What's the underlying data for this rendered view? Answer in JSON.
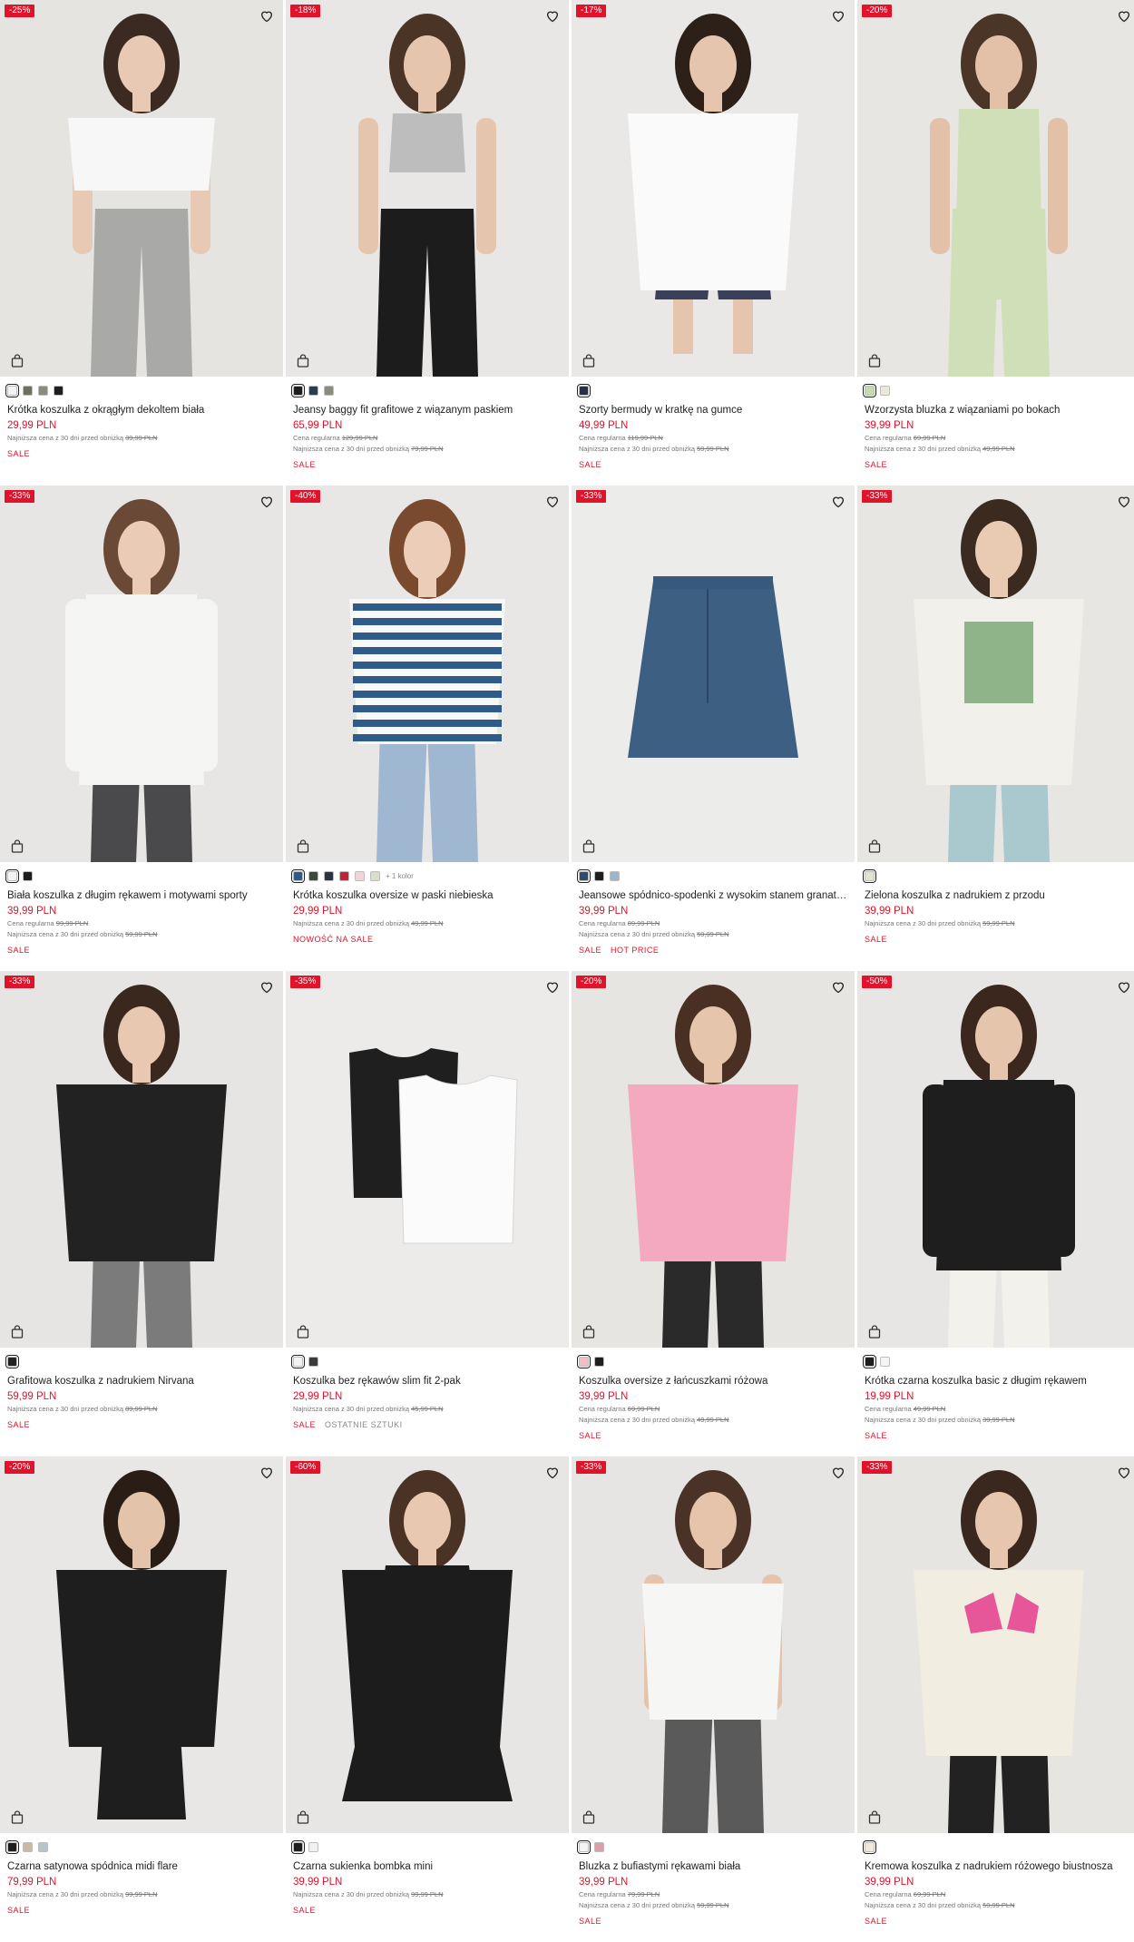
{
  "products": [
    {
      "badge": "-25%",
      "name": "Krótka koszulka z okrągłym dekoltem biała",
      "price": "29,99 PLN",
      "regular": "",
      "lowest_label": "Najniższa cena z 30 dni przed obniżką",
      "lowest_price": "39,99 PLN",
      "tags": [
        "SALE"
      ],
      "swatches": [
        "#f3f3f3",
        "#6b705f",
        "#8a8a80",
        "#1e1e1e"
      ],
      "more": ""
    },
    {
      "badge": "-18%",
      "name": "Jeansy baggy fit grafitowe z wiązanym paskiem",
      "price": "65,99 PLN",
      "regular_label": "Cena regularna",
      "regular": "129,99 PLN",
      "lowest_label": "Najniższa cena z 30 dni przed obniżką",
      "lowest_price": "79,99 PLN",
      "tags": [
        "SALE"
      ],
      "swatches": [
        "#1e1e1e",
        "#2a3d4f",
        "#8c8c7e"
      ],
      "more": ""
    },
    {
      "badge": "-17%",
      "name": "Szorty bermudy w kratkę na gumce",
      "price": "49,99 PLN",
      "regular_label": "Cena regularna",
      "regular": "119,99 PLN",
      "lowest_label": "Najniższa cena z 30 dni przed obniżką",
      "lowest_price": "59,99 PLN",
      "tags": [
        "SALE"
      ],
      "swatches": [
        "#2b2f45"
      ],
      "more": ""
    },
    {
      "badge": "-20%",
      "name": "Wzorzysta bluzka z wiązaniami po bokach",
      "price": "39,99 PLN",
      "regular_label": "Cena regularna",
      "regular": "69,99 PLN",
      "lowest_label": "Najniższa cena z 30 dni przed obniżką",
      "lowest_price": "49,99 PLN",
      "tags": [
        "SALE"
      ],
      "swatches": [
        "#c8d8b2",
        "#ece9dc"
      ],
      "more": ""
    },
    {
      "badge": "-33%",
      "name": "Biała koszulka z długim rękawem i motywami sporty",
      "price": "39,99 PLN",
      "regular_label": "Cena regularna",
      "regular": "99,99 PLN",
      "lowest_label": "Najniższa cena z 30 dni przed obniżką",
      "lowest_price": "59,99 PLN",
      "tags": [
        "SALE"
      ],
      "swatches": [
        "#f4f4f4",
        "#1e1e1e"
      ],
      "more": ""
    },
    {
      "badge": "-40%",
      "name": "Krótka koszulka oversize w paski niebieska",
      "price": "29,99 PLN",
      "regular": "",
      "lowest_label": "Najniższa cena z 30 dni przed obniżką",
      "lowest_price": "49,99 PLN",
      "tags": [
        "NOWOŚĆ NA SALE"
      ],
      "swatches": [
        "#2f5b8a",
        "#3d4a3a",
        "#2a3340",
        "#c7213a",
        "#f0d5d8",
        "#d8dec8"
      ],
      "more": "+ 1 kolor"
    },
    {
      "badge": "-33%",
      "name": "Jeansowe spódnico-spodenki z wysokim stanem granato...",
      "price": "39,99 PLN",
      "regular_label": "Cena regularna",
      "regular": "89,99 PLN",
      "lowest_label": "Najniższa cena z 30 dni przed obniżką",
      "lowest_price": "59,99 PLN",
      "tags": [
        "SALE",
        "HOT PRICE"
      ],
      "swatches": [
        "#2e4c6e",
        "#1e1e1e",
        "#9fb5c9"
      ],
      "more": ""
    },
    {
      "badge": "-33%",
      "name": "Zielona koszulka z nadrukiem z przodu",
      "price": "39,99 PLN",
      "regular": "",
      "lowest_label": "Najniższa cena z 30 dni przed obniżką",
      "lowest_price": "59,99 PLN",
      "tags": [
        "SALE"
      ],
      "swatches": [
        "#dfe3cf"
      ],
      "more": ""
    },
    {
      "badge": "-33%",
      "name": "Grafitowa koszulka z nadrukiem Nirvana",
      "price": "59,99 PLN",
      "regular": "",
      "lowest_label": "Najniższa cena z 30 dni przed obniżką",
      "lowest_price": "89,99 PLN",
      "tags": [
        "SALE"
      ],
      "swatches": [
        "#222222"
      ],
      "more": ""
    },
    {
      "badge": "-35%",
      "name": "Koszulka bez rękawów slim fit 2-pak",
      "price": "29,99 PLN",
      "regular": "",
      "lowest_label": "Najniższa cena z 30 dni przed obniżką",
      "lowest_price": "45,99 PLN",
      "tags": [
        "SALE",
        "OSTATNIE SZTUKI"
      ],
      "swatches": [
        "#f2f2f2",
        "#3a3a3a"
      ],
      "more": ""
    },
    {
      "badge": "-20%",
      "name": "Koszulka oversize z łańcuszkami różowa",
      "price": "39,99 PLN",
      "regular_label": "Cena regularna",
      "regular": "69,99 PLN",
      "lowest_label": "Najniższa cena z 30 dni przed obniżką",
      "lowest_price": "49,99 PLN",
      "tags": [
        "SALE"
      ],
      "swatches": [
        "#f3bcc9",
        "#1e1e1e"
      ],
      "more": ""
    },
    {
      "badge": "-50%",
      "name": "Krótka czarna koszulka basic z długim rękawem",
      "price": "19,99 PLN",
      "regular_label": "Cena regularna",
      "regular": "49,99 PLN",
      "lowest_label": "Najniższa cena z 30 dni przed obniżką",
      "lowest_price": "39,99 PLN",
      "tags": [
        "SALE"
      ],
      "swatches": [
        "#1e1e1e",
        "#f4f4f4"
      ],
      "more": ""
    },
    {
      "badge": "-20%",
      "name": "Czarna satynowa spódnica midi flare",
      "price": "79,99 PLN",
      "regular": "",
      "lowest_label": "Najniższa cena z 30 dni przed obniżką",
      "lowest_price": "99,99 PLN",
      "tags": [
        "SALE"
      ],
      "swatches": [
        "#1e1e1e",
        "#c9b9a4",
        "#b8c4cc"
      ],
      "more": ""
    },
    {
      "badge": "-60%",
      "name": "Czarna sukienka bombka mini",
      "price": "39,99 PLN",
      "regular": "",
      "lowest_label": "Najniższa cena z 30 dni przed obniżką",
      "lowest_price": "99,99 PLN",
      "tags": [
        "SALE"
      ],
      "swatches": [
        "#1e1e1e",
        "#f0f0f0"
      ],
      "more": ""
    },
    {
      "badge": "-33%",
      "name": "Bluzka z bufiastymi rękawami biała",
      "price": "39,99 PLN",
      "regular_label": "Cena regularna",
      "regular": "79,99 PLN",
      "lowest_label": "Najniższa cena z 30 dni przed obniżką",
      "lowest_price": "59,99 PLN",
      "tags": [
        "SALE"
      ],
      "swatches": [
        "#f4f4f4",
        "#d9a0a8"
      ],
      "more": ""
    },
    {
      "badge": "-33%",
      "name": "Kremowa koszulka z nadrukiem różowego biustnosza",
      "price": "39,99 PLN",
      "regular_label": "Cena regularna",
      "regular": "69,99 PLN",
      "lowest_label": "Najniższa cena z 30 dni przed obniżką",
      "lowest_price": "59,99 PLN",
      "tags": [
        "SALE"
      ],
      "swatches": [
        "#efeadb"
      ],
      "more": ""
    }
  ],
  "colors": {
    "accent": "#e0132b",
    "text": "#1a1a1a",
    "muted": "#777777"
  },
  "icons": {
    "favorite": "heart-icon",
    "bag": "shopping-bag-icon"
  }
}
